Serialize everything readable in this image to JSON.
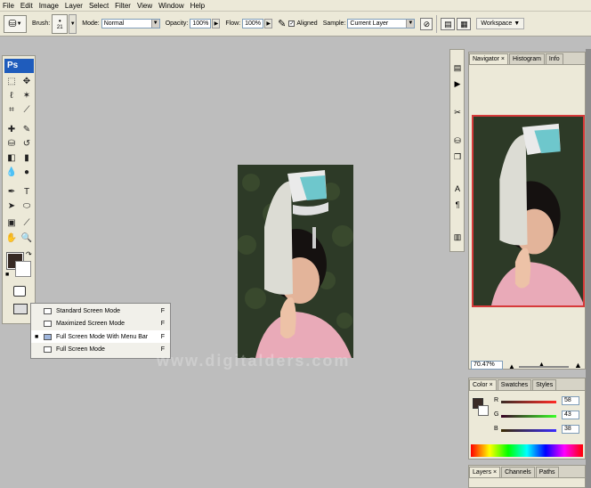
{
  "menu": [
    "File",
    "Edit",
    "Image",
    "Layer",
    "Select",
    "Filter",
    "View",
    "Window",
    "Help"
  ],
  "options": {
    "brush_label": "Brush:",
    "brush_size": "21",
    "mode_label": "Mode:",
    "mode_value": "Normal",
    "opacity_label": "Opacity:",
    "opacity_value": "100%",
    "flow_label": "Flow:",
    "flow_value": "100%",
    "aligned_label": "Aligned",
    "sample_label": "Sample:",
    "sample_value": "Current Layer",
    "workspace_label": "Workspace ▼"
  },
  "toolbox": {
    "logo": "Ps"
  },
  "screen_mode_menu": [
    {
      "label": "Standard Screen Mode",
      "key": "F",
      "selected": false
    },
    {
      "label": "Maximized Screen Mode",
      "key": "F",
      "selected": false
    },
    {
      "label": "Full Screen Mode With Menu Bar",
      "key": "F",
      "selected": true
    },
    {
      "label": "Full Screen Mode",
      "key": "F",
      "selected": false
    }
  ],
  "watermark": "www.digitalders.com",
  "navigator": {
    "tabs": [
      "Navigator",
      "Histogram",
      "Info"
    ],
    "zoom": "70.47%"
  },
  "color": {
    "tabs": [
      "Color",
      "Swatches",
      "Styles"
    ],
    "r_label": "R",
    "r_value": "58",
    "g_label": "G",
    "g_value": "43",
    "b_label": "B",
    "b_value": "38"
  },
  "layers": {
    "tabs": [
      "Layers",
      "Channels",
      "Paths"
    ]
  },
  "colors": {
    "fg": "#3a2b26",
    "accent_red": "#d63a3a"
  }
}
